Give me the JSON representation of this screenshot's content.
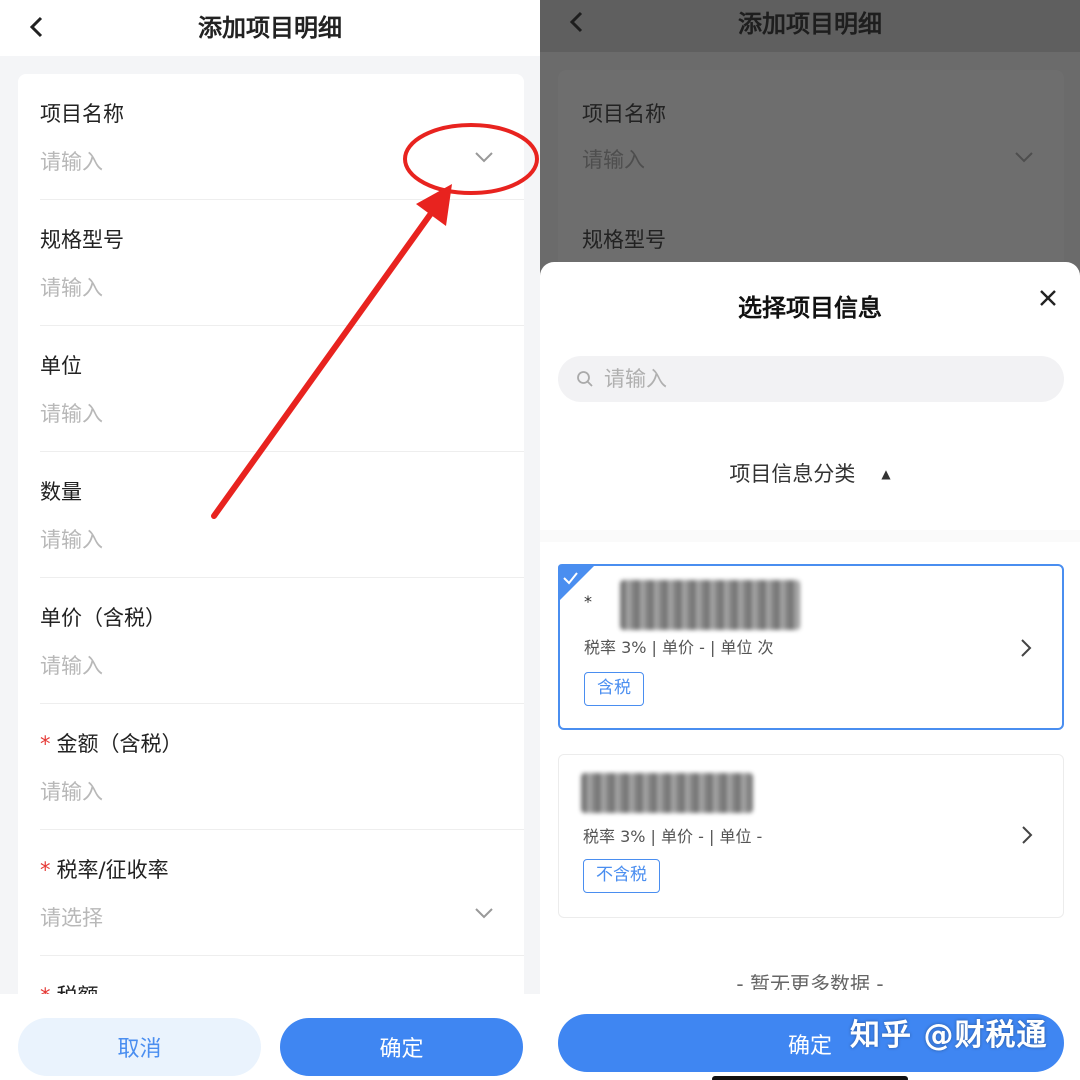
{
  "left": {
    "nav_title": "添加项目明细",
    "fields": [
      {
        "label": "项目名称",
        "placeholder": "请输入",
        "required": false,
        "dropdown": true
      },
      {
        "label": "规格型号",
        "placeholder": "请输入",
        "required": false,
        "dropdown": false
      },
      {
        "label": "单位",
        "placeholder": "请输入",
        "required": false,
        "dropdown": false
      },
      {
        "label": "数量",
        "placeholder": "请输入",
        "required": false,
        "dropdown": false
      },
      {
        "label": "单价（含税）",
        "placeholder": "请输入",
        "required": false,
        "dropdown": false
      },
      {
        "label": "金额（含税）",
        "placeholder": "请输入",
        "required": true,
        "dropdown": false
      },
      {
        "label": "税率/征收率",
        "placeholder": "请选择",
        "required": true,
        "dropdown": true
      },
      {
        "label": "税额",
        "placeholder": "",
        "required": true,
        "dropdown": false
      }
    ],
    "required_mark": "*",
    "cancel_label": "取消",
    "confirm_label": "确定"
  },
  "right": {
    "nav_title": "添加项目明细",
    "bg_fields": [
      {
        "label": "项目名称",
        "placeholder": "请输入"
      },
      {
        "label": "规格型号"
      }
    ],
    "sheet": {
      "title": "选择项目信息",
      "search_placeholder": "请输入",
      "category_label": "项目信息分类",
      "category_indicator": "▲",
      "items": [
        {
          "prefix": "*",
          "info": "税率 3% | 单价 - | 单位 次",
          "tag": "含税",
          "selected": true
        },
        {
          "prefix": "",
          "info": "税率 3% | 单价 - | 单位 -",
          "tag": "不含税",
          "selected": false
        }
      ],
      "no_more": "- 暂无更多数据 -",
      "confirm_label": "确定"
    },
    "watermark": "知乎 @财税通"
  },
  "colors": {
    "accent": "#3f86f2",
    "required": "#e53935",
    "annotation": "#e8231f"
  },
  "icons": [
    "back-icon",
    "chevron-down-icon",
    "close-icon",
    "search-icon",
    "chevron-right-icon",
    "check-icon"
  ]
}
